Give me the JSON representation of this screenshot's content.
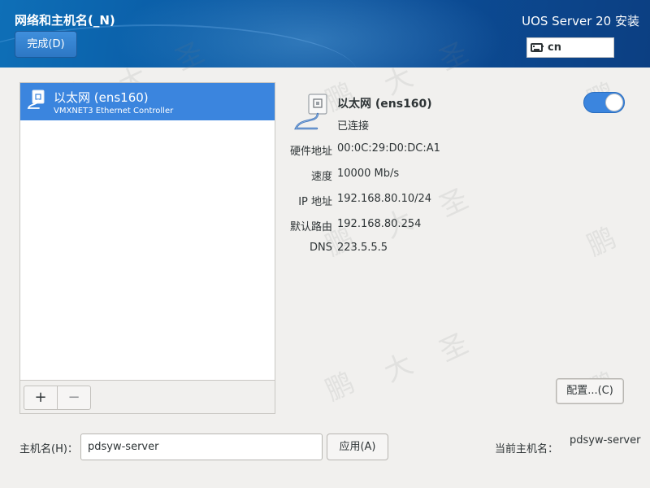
{
  "header": {
    "page_title": "网络和主机名(_N)",
    "done_label": "完成(D)",
    "installer_title": "UOS Server 20 安装",
    "keyboard_layout": "cn"
  },
  "device_list": {
    "items": [
      {
        "name": "以太网 (ens160)",
        "description": "VMXNET3 Ethernet Controller",
        "selected": true
      }
    ],
    "add_label": "+",
    "remove_label": "−"
  },
  "detail": {
    "name": "以太网 (ens160)",
    "status": "已连接",
    "enabled": true,
    "properties": [
      {
        "label": "硬件地址",
        "value": "00:0C:29:D0:DC:A1"
      },
      {
        "label": "速度",
        "value": "10000 Mb/s"
      },
      {
        "label": "IP 地址",
        "value": "192.168.80.10/24"
      },
      {
        "label": "默认路由",
        "value": "192.168.80.254"
      },
      {
        "label": "DNS",
        "value": "223.5.5.5"
      }
    ],
    "config_label": "配置...(C)"
  },
  "hostname": {
    "label": "主机名(H)：",
    "value": "pdsyw-server",
    "apply_label": "应用(A)",
    "current_label": "当前主机名：",
    "current_value": "pdsyw-server"
  },
  "watermark": {
    "chars": [
      "鹏",
      "大",
      "圣"
    ]
  },
  "colors": {
    "accent": "#3b85de",
    "header_start": "#0e6fb7",
    "header_end": "#0c3f82",
    "background": "#f1f0ee"
  }
}
